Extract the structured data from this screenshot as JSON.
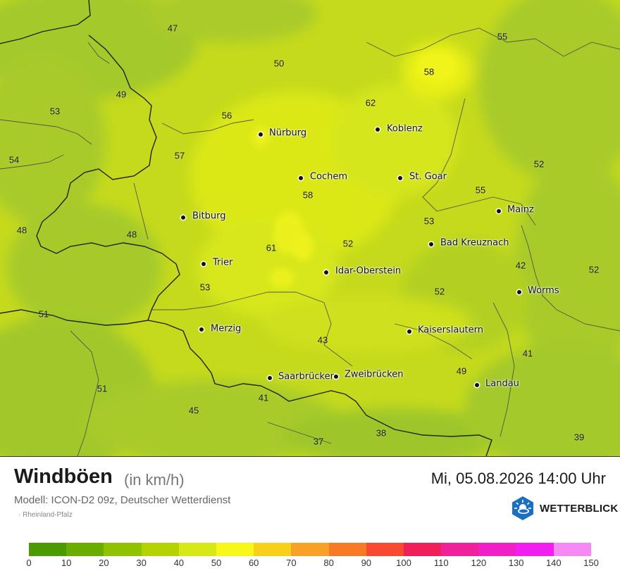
{
  "map": {
    "region_numbers": [
      {
        "v": "47"
      },
      {
        "v": "55"
      },
      {
        "v": "50"
      },
      {
        "v": "58"
      },
      {
        "v": "49"
      },
      {
        "v": "62"
      },
      {
        "v": "53"
      },
      {
        "v": "56"
      },
      {
        "v": "57"
      },
      {
        "v": "54"
      },
      {
        "v": "52"
      },
      {
        "v": "58"
      },
      {
        "v": "55"
      },
      {
        "v": "48"
      },
      {
        "v": "48"
      },
      {
        "v": "53"
      },
      {
        "v": "61"
      },
      {
        "v": "52"
      },
      {
        "v": "42"
      },
      {
        "v": "52"
      },
      {
        "v": "53"
      },
      {
        "v": "52"
      },
      {
        "v": "51"
      },
      {
        "v": "43"
      },
      {
        "v": "41"
      },
      {
        "v": "49"
      },
      {
        "v": "51"
      },
      {
        "v": "41"
      },
      {
        "v": "45"
      },
      {
        "v": "38"
      },
      {
        "v": "37"
      },
      {
        "v": "39"
      }
    ],
    "cities": [
      {
        "name": "Nürburg"
      },
      {
        "name": "Koblenz"
      },
      {
        "name": "Cochem"
      },
      {
        "name": "St. Goar"
      },
      {
        "name": "Mainz"
      },
      {
        "name": "Bitburg"
      },
      {
        "name": "Bad Kreuznach"
      },
      {
        "name": "Trier"
      },
      {
        "name": "Idar-Oberstein"
      },
      {
        "name": "Worms"
      },
      {
        "name": "Merzig"
      },
      {
        "name": "Kaiserslautern"
      },
      {
        "name": "Saarbrücken"
      },
      {
        "name": "Zweibrücken"
      },
      {
        "name": "Landau"
      }
    ]
  },
  "footer": {
    "title": "Windböen",
    "unit": "(in km/h)",
    "datetime": "Mi, 05.08.2026 14:00 Uhr",
    "model": "Modell: ICON-D2 09z, Deutscher Wetterdienst",
    "region": "· Rheinland-Pfalz",
    "brand": "WETTERBLICK",
    "brand_icon": "sun-cloud-logo-icon"
  },
  "scale": {
    "colors": [
      "#4a9a00",
      "#6aad00",
      "#8fc300",
      "#b4d300",
      "#d6e818",
      "#f7f71a",
      "#f7d01a",
      "#f7a226",
      "#f77a26",
      "#f74a2e",
      "#f01f5a",
      "#f01f9a",
      "#f01fc8",
      "#f01ff0",
      "#f58af5"
    ],
    "ticks": [
      "0",
      "10",
      "20",
      "30",
      "40",
      "50",
      "60",
      "70",
      "80",
      "90",
      "100",
      "110",
      "120",
      "130",
      "140",
      "150"
    ]
  },
  "colors": {
    "map_base": "#c9dc1a",
    "map_green": "#a9cc2a",
    "map_yellow": "#eef21a"
  }
}
